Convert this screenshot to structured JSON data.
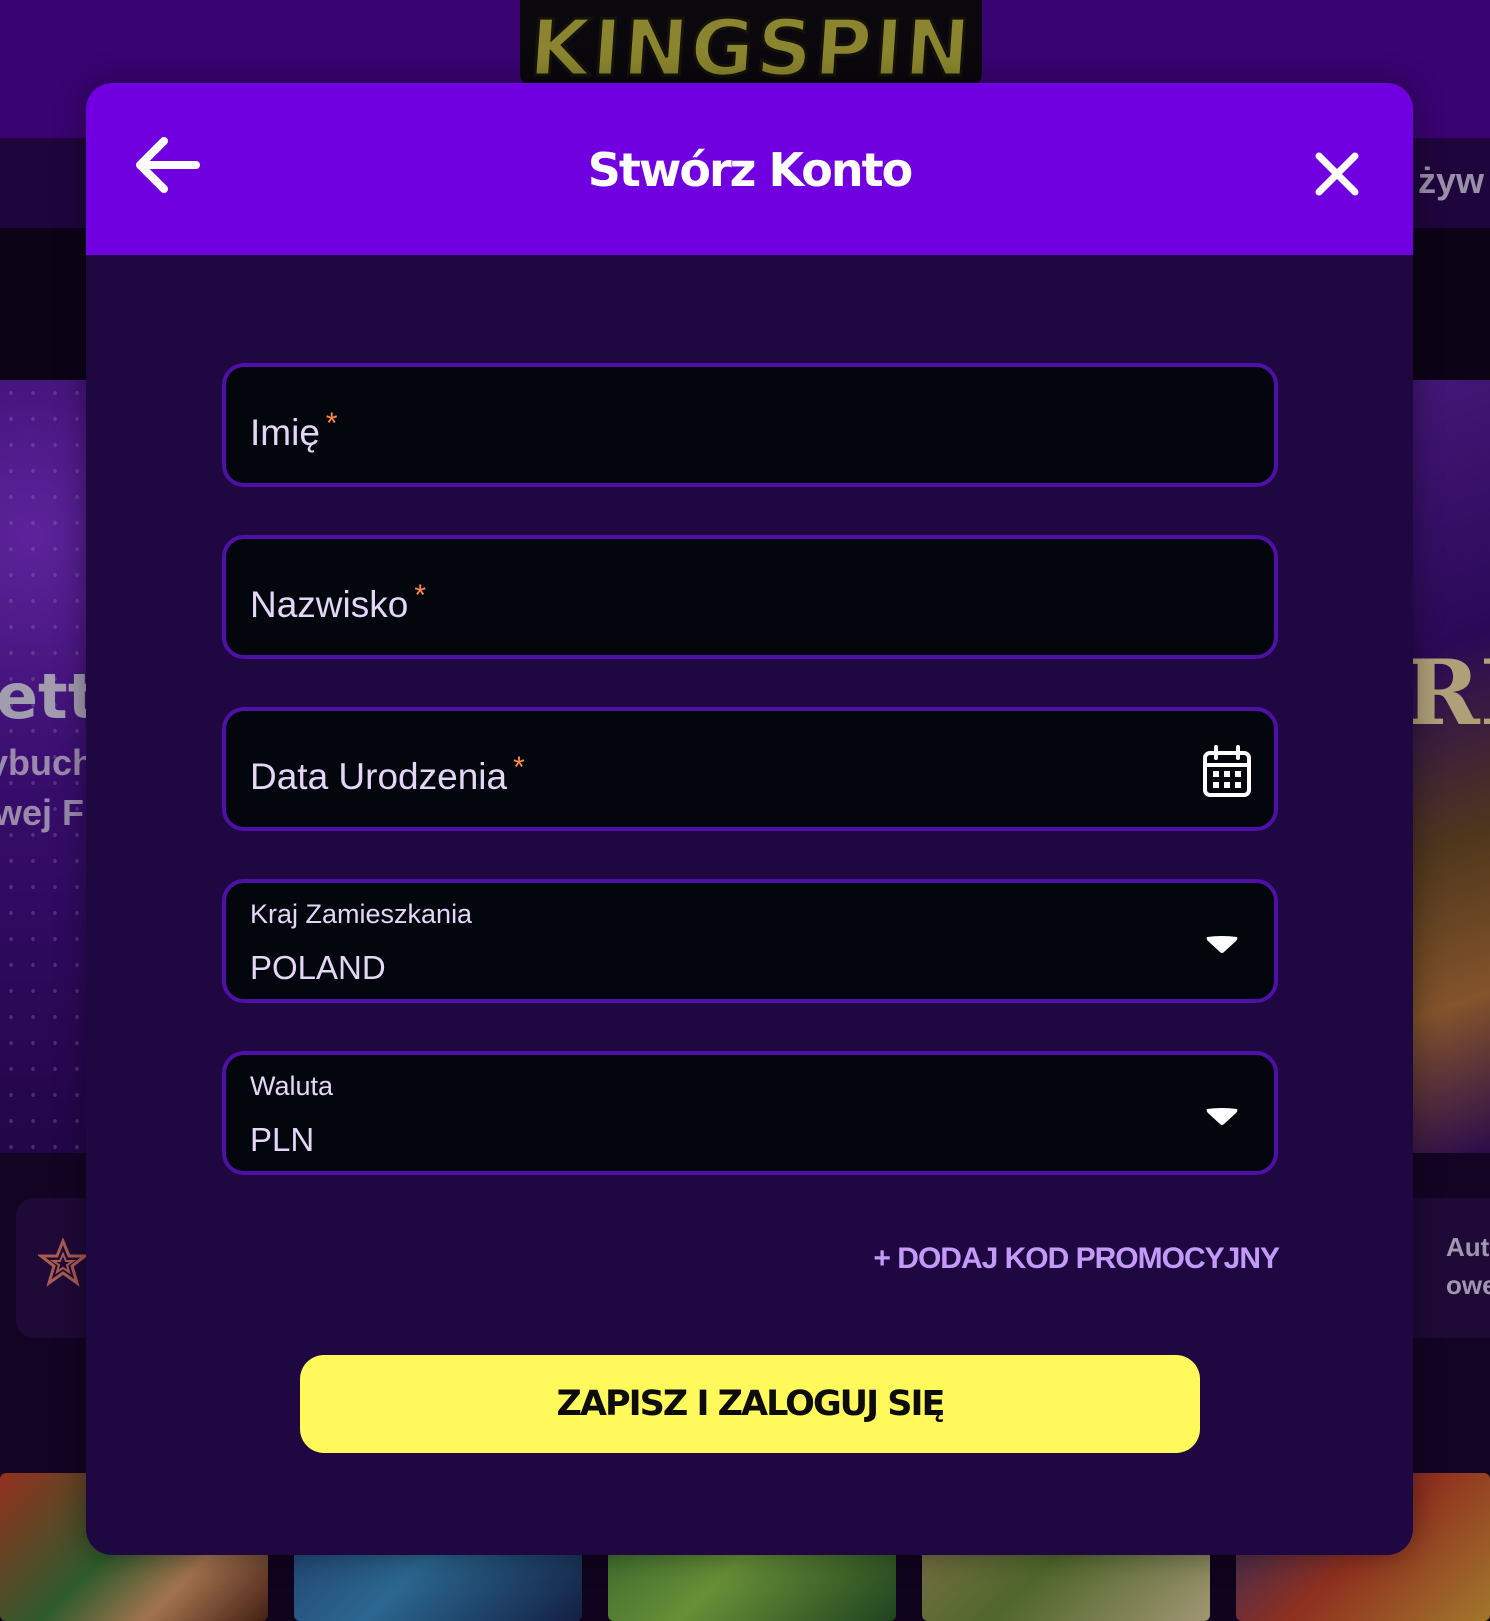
{
  "brand": {
    "logo_text": "KINGSPIN"
  },
  "background": {
    "nav_right_fragment": "żyw",
    "hero_left_line1": "ett",
    "hero_left_line2": "ybuch",
    "hero_left_line3": "wej F",
    "hero_right_fragment": "RE",
    "card_right_line1": "Aut",
    "card_right_line2": "owe"
  },
  "modal": {
    "title": "Stwórz Konto",
    "back_icon": "arrow-left-icon",
    "close_icon": "close-icon",
    "fields": {
      "first_name": {
        "label": "Imię",
        "required_mark": "*"
      },
      "last_name": {
        "label": "Nazwisko",
        "required_mark": "*"
      },
      "birth_date": {
        "label": "Data Urodzenia",
        "required_mark": "*",
        "icon": "calendar-icon"
      },
      "country": {
        "label": "Kraj Zamieszkania",
        "value": "POLAND",
        "icon": "chevron-down-icon"
      },
      "currency": {
        "label": "Waluta",
        "value": "PLN",
        "icon": "chevron-down-icon"
      }
    },
    "promo_link": "+ DODAJ KOD PROMOCYJNY",
    "submit_label": "ZAPISZ I ZALOGUJ SIĘ"
  },
  "colors": {
    "header_purple": "#7100e0",
    "modal_bg": "#1f0842",
    "field_border": "#4e10a6",
    "submit_yellow": "#fff95c",
    "required_orange": "#ff8a4b",
    "promo_purple": "#c49af9"
  }
}
